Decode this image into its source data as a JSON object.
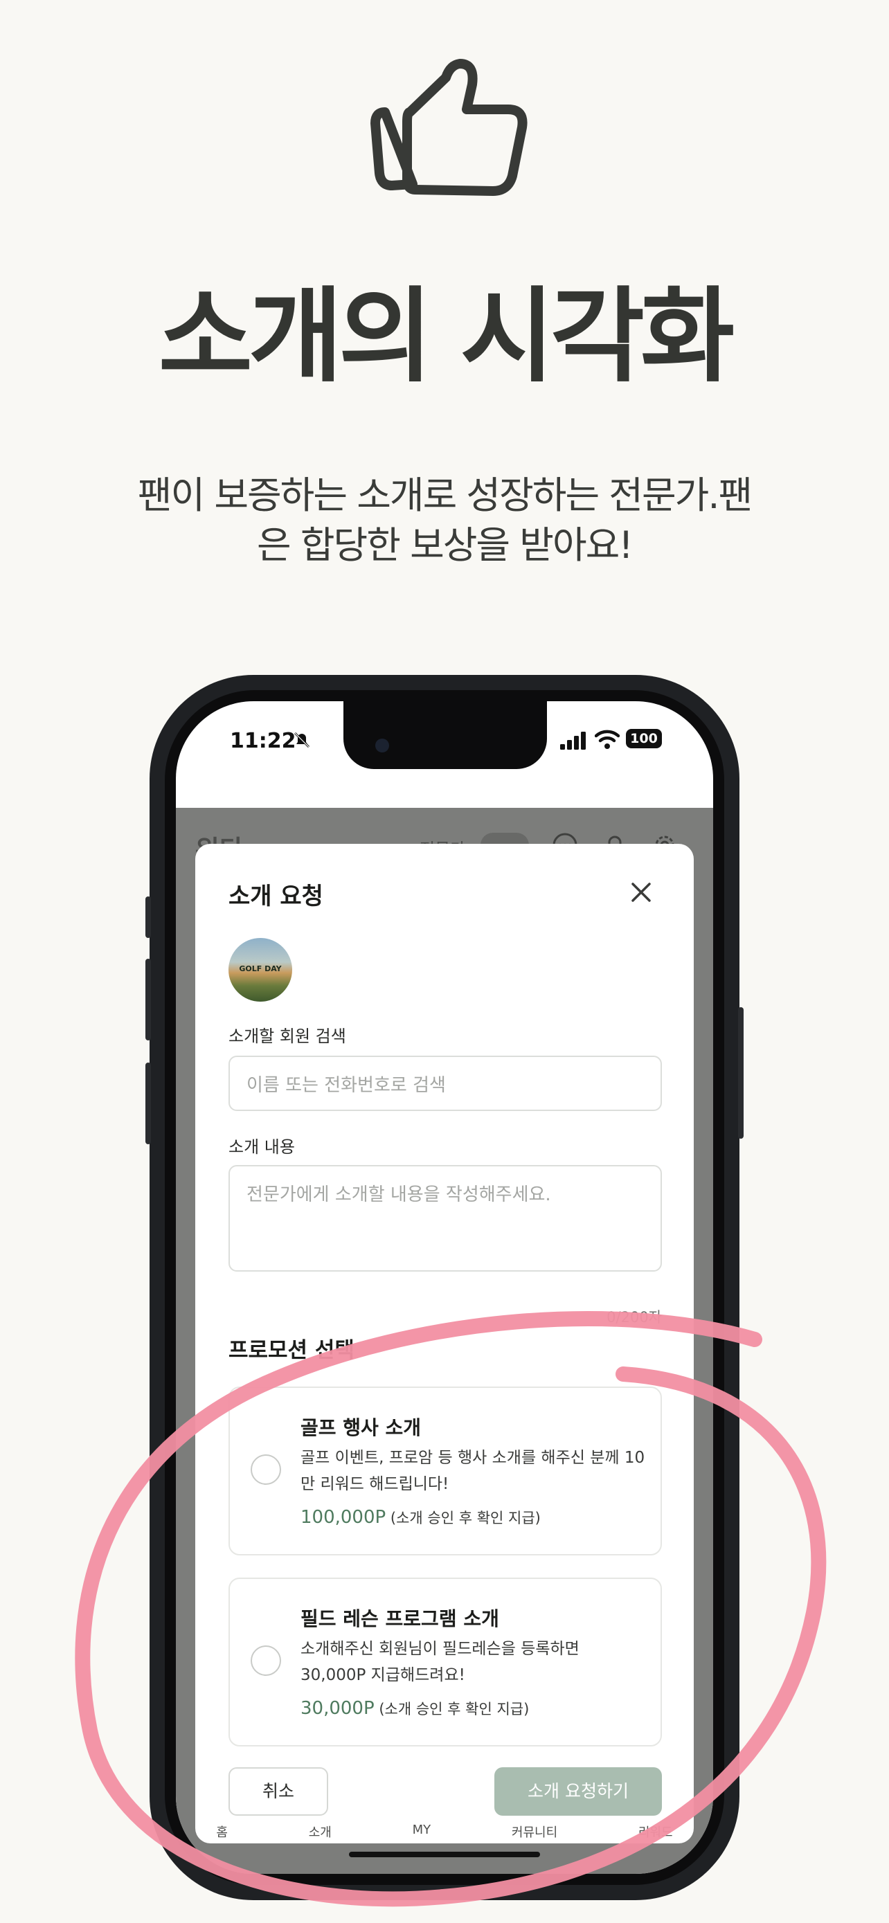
{
  "hero": {
    "icon": "thumbs-up-icon",
    "title": "소개의 시각화",
    "subtitle_line1": "팬이 보증하는 소개로 성장하는 전문가.팬",
    "subtitle_line2": "은 합당한 보상을 받아요!"
  },
  "status_bar": {
    "time": "11:22",
    "battery": "100"
  },
  "app_header": {
    "logo": "위다",
    "expert_toggle_label": "전문가"
  },
  "tab_bar": {
    "items": [
      "홈",
      "소개",
      "MY",
      "커뮤니티",
      "리워드"
    ]
  },
  "modal": {
    "title": "소개 요청",
    "avatar_text": "GOLF DAY",
    "search_label": "소개할 회원 검색",
    "search_placeholder": "이름 또는 전화번호로 검색",
    "content_label": "소개 내용",
    "content_placeholder": "전문가에게 소개할 내용을 작성해주세요.",
    "counter": "0/200자",
    "promotion_title": "프로모션 선택",
    "promotions": [
      {
        "title": "골프 행사 소개",
        "desc": "골프 이벤트, 프로암 등 행사 소개를 해주신 분께 10만 리워드 해드립니다!",
        "reward": "100,000P",
        "note": "(소개 승인 후 확인 지급)"
      },
      {
        "title": "필드 레슨 프로그램 소개",
        "desc": "소개해주신 회원님이 필드레슨을 등록하면 30,000P 지급해드려요!",
        "reward": "30,000P",
        "note": "(소개 승인 후 확인 지급)"
      }
    ],
    "cancel_label": "취소",
    "submit_label": "소개 요청하기"
  },
  "colors": {
    "background": "#f9f8f4",
    "accent_green": "#4f7b5f",
    "submit_disabled": "#a9bdb0",
    "highlight_circle": "#f28fa2"
  }
}
